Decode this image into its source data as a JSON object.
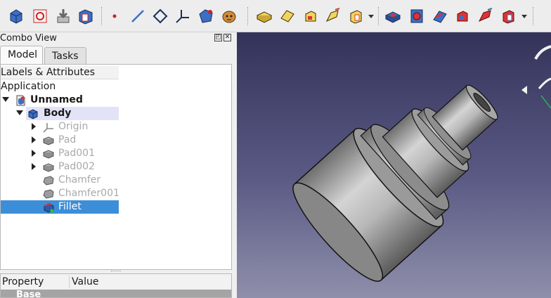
{
  "toolbar": {
    "icons": [
      "body-icon",
      "sketch-icon",
      "attach-icon",
      "clone-icon",
      "point-icon",
      "line-icon",
      "plane-icon",
      "lcs-icon",
      "shapebinder-icon",
      "subshapebinder-icon",
      "pad-icon",
      "revolution-icon",
      "additive-loft-icon",
      "additive-pipe-icon",
      "additive-primitive-icon",
      "pocket-icon",
      "hole-icon",
      "groove-icon",
      "subtractive-loft-icon",
      "subtractive-pipe-icon",
      "subtractive-primitive-icon"
    ]
  },
  "combo": {
    "title": "Combo View",
    "tabs": {
      "model": "Model",
      "tasks": "Tasks"
    }
  },
  "tree": {
    "header": "Labels & Attributes",
    "application": "Application",
    "document": "Unnamed",
    "body": "Body",
    "items": [
      {
        "label": "Origin",
        "icon": "origin-icon",
        "state": "dimmed",
        "expandable": true
      },
      {
        "label": "Pad",
        "icon": "pad-icon",
        "state": "dimmed",
        "expandable": true
      },
      {
        "label": "Pad001",
        "icon": "pad-icon",
        "state": "dimmed",
        "expandable": true
      },
      {
        "label": "Pad002",
        "icon": "pad-icon",
        "state": "dimmed",
        "expandable": true
      },
      {
        "label": "Chamfer",
        "icon": "chamfer-icon",
        "state": "dimmed",
        "expandable": false
      },
      {
        "label": "Chamfer001",
        "icon": "chamfer-icon",
        "state": "dimmed",
        "expandable": false
      },
      {
        "label": "Fillet",
        "icon": "fillet-icon",
        "state": "selected",
        "expandable": false
      }
    ]
  },
  "properties": {
    "col_property": "Property",
    "col_value": "Value",
    "group": "Base"
  },
  "colors": {
    "selection": "#3d8ed8",
    "body_highlight": "#e3e3f7",
    "view_top": "#33335a",
    "view_bottom": "#8f8fab"
  }
}
